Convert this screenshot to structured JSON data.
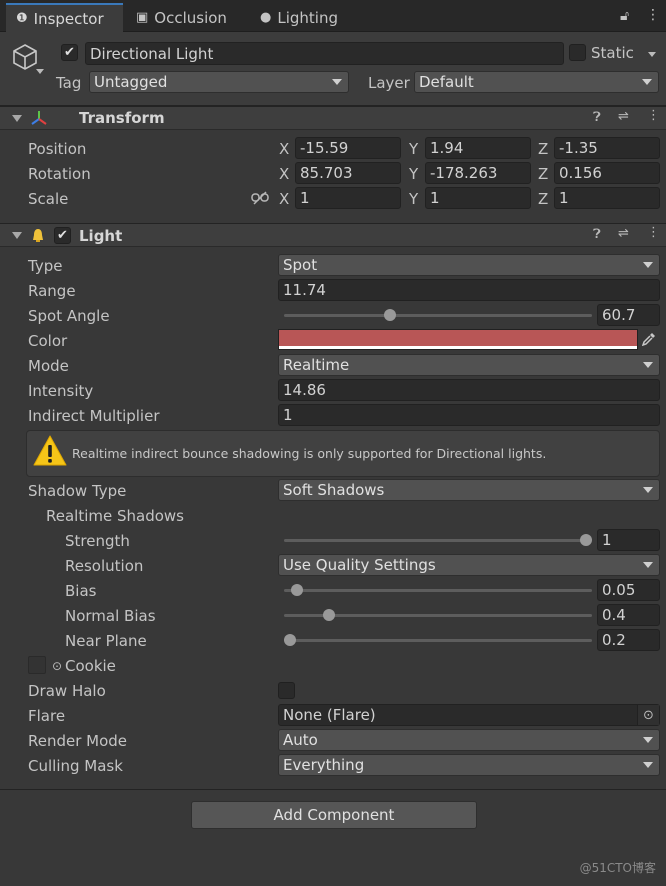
{
  "tabs": [
    {
      "label": "Inspector",
      "icon": "info-icon",
      "active": true
    },
    {
      "label": "Occlusion",
      "icon": "occlusion-icon",
      "active": false
    },
    {
      "label": "Lighting",
      "icon": "bulb-icon",
      "active": false
    }
  ],
  "header": {
    "object_name": "Directional Light",
    "active_checked": true,
    "static_label": "Static",
    "static_checked": false,
    "tag_label": "Tag",
    "tag_value": "Untagged",
    "layer_label": "Layer",
    "layer_value": "Default"
  },
  "transform": {
    "title": "Transform",
    "rows": [
      {
        "label": "Position",
        "x": "-15.59",
        "y": "1.94",
        "z": "-1.35"
      },
      {
        "label": "Rotation",
        "x": "85.703",
        "y": "-178.263",
        "z": "0.156"
      },
      {
        "label": "Scale",
        "x": "1",
        "y": "1",
        "z": "1"
      }
    ],
    "axis_x": "X",
    "axis_y": "Y",
    "axis_z": "Z"
  },
  "light": {
    "title": "Light",
    "enabled": true,
    "type_label": "Type",
    "type_value": "Spot",
    "range_label": "Range",
    "range_value": "11.74",
    "spot_angle_label": "Spot Angle",
    "spot_angle_value": "60.7",
    "spot_angle_fraction": 0.339,
    "color_label": "Color",
    "color_value": "#b85656",
    "mode_label": "Mode",
    "mode_value": "Realtime",
    "intensity_label": "Intensity",
    "intensity_value": "14.86",
    "indirect_label": "Indirect Multiplier",
    "indirect_value": "1",
    "warning": "Realtime indirect bounce shadowing is only supported for Directional lights.",
    "shadow_type_label": "Shadow Type",
    "shadow_type_value": "Soft Shadows",
    "realtime_shadows_label": "Realtime Shadows",
    "strength_label": "Strength",
    "strength_value": "1",
    "strength_fraction": 1.0,
    "resolution_label": "Resolution",
    "resolution_value": "Use Quality Settings",
    "bias_label": "Bias",
    "bias_value": "0.05",
    "bias_fraction": 0.025,
    "normal_bias_label": "Normal Bias",
    "normal_bias_value": "0.4",
    "normal_bias_fraction": 0.133,
    "near_plane_label": "Near Plane",
    "near_plane_value": "0.2",
    "near_plane_fraction": 0.0,
    "cookie_label": "Cookie",
    "draw_halo_label": "Draw Halo",
    "flare_label": "Flare",
    "flare_value": "None (Flare)",
    "render_mode_label": "Render Mode",
    "render_mode_value": "Auto",
    "culling_mask_label": "Culling Mask",
    "culling_mask_value": "Everything"
  },
  "add_component_label": "Add Component",
  "watermark": "@51CTO博客"
}
